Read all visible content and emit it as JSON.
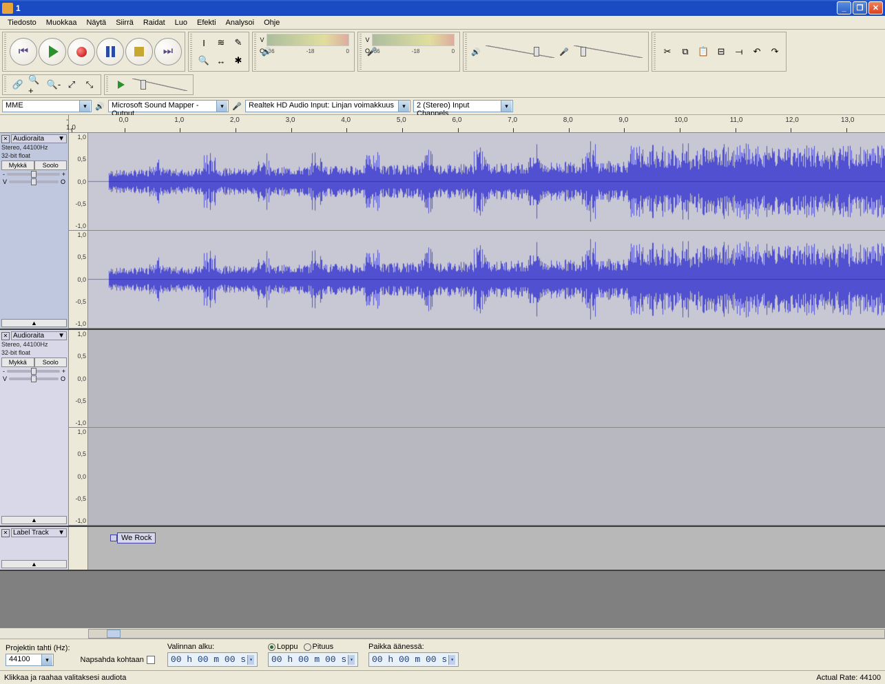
{
  "window": {
    "title": "1"
  },
  "menu": [
    "Tiedosto",
    "Muokkaa",
    "Näytä",
    "Siirrä",
    "Raidat",
    "Luo",
    "Efekti",
    "Analysoi",
    "Ohje"
  ],
  "meterLabels": [
    "-36",
    "-18",
    "0"
  ],
  "slider_letters": {
    "v": "V",
    "o": "O"
  },
  "devices": {
    "host": "MME",
    "output": "Microsoft Sound Mapper - Output",
    "input": "Realtek HD Audio Input: Linjan voimakkuus",
    "channels": "2 (Stereo) Input Channels"
  },
  "ruler": [
    "- 1,0",
    "0,0",
    "1,0",
    "2,0",
    "3,0",
    "4,0",
    "5,0",
    "6,0",
    "7,0",
    "8,0",
    "9,0",
    "10,0",
    "11,0",
    "12,0",
    "13,0"
  ],
  "tracks": [
    {
      "name": "Audioraita",
      "format": "Stereo, 44100Hz",
      "depth": "32-bit float",
      "mute": "Mykkä",
      "solo": "Soolo",
      "gain_minus": "-",
      "gain_plus": "+",
      "pan_v": "V",
      "pan_o": "O",
      "selected": true,
      "hasAudio": true
    },
    {
      "name": "Audioraita",
      "format": "Stereo, 44100Hz",
      "depth": "32-bit float",
      "mute": "Mykkä",
      "solo": "Soolo",
      "gain_minus": "-",
      "gain_plus": "+",
      "pan_v": "V",
      "pan_o": "O",
      "selected": false,
      "hasAudio": false
    }
  ],
  "labelTrack": {
    "name": "Label Track",
    "label": "We Rock"
  },
  "amplitudes": [
    "1,0",
    "0,5",
    "0,0",
    "-0,5",
    "-1,0"
  ],
  "selection": {
    "projectRateLabel": "Projektin tahti (Hz):",
    "projectRate": "44100",
    "snapLabel": "Napsahda kohtaan",
    "startLabel": "Valinnan alku:",
    "endLabel": "Loppu",
    "lengthLabel": "Pituus",
    "posLabel": "Paikka äänessä:",
    "time1": "00 h 00 m 00 s",
    "time2": "00 h 00 m 00 s",
    "time3": "00 h 00 m 00 s"
  },
  "status": {
    "left": "Klikkaa ja raahaa valitaksesi audiota",
    "right": "Actual Rate: 44100"
  }
}
